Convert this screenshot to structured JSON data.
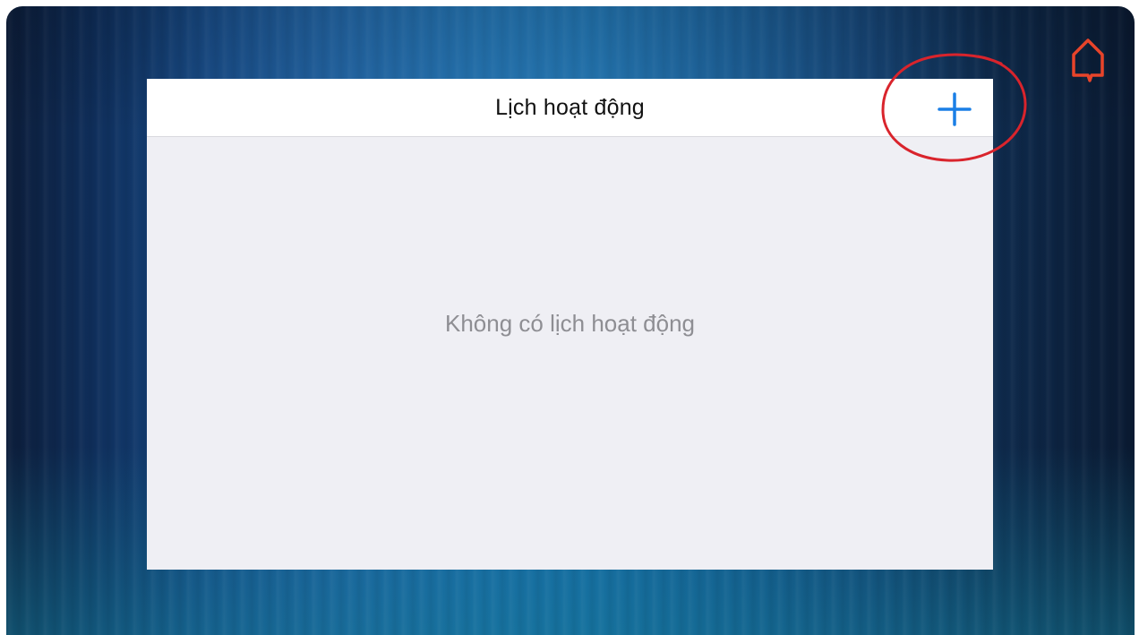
{
  "panel": {
    "title": "Lịch hoạt động",
    "empty_message": "Không có lịch hoạt động",
    "add_icon": "plus-icon"
  },
  "home_icon": "home-icon",
  "colors": {
    "accent_blue": "#1a7fe6",
    "home_orange": "#e8442a",
    "highlight_red": "#d9242c",
    "panel_bg": "#efeff4",
    "header_bg": "#ffffff",
    "empty_text": "#8e8e93"
  }
}
